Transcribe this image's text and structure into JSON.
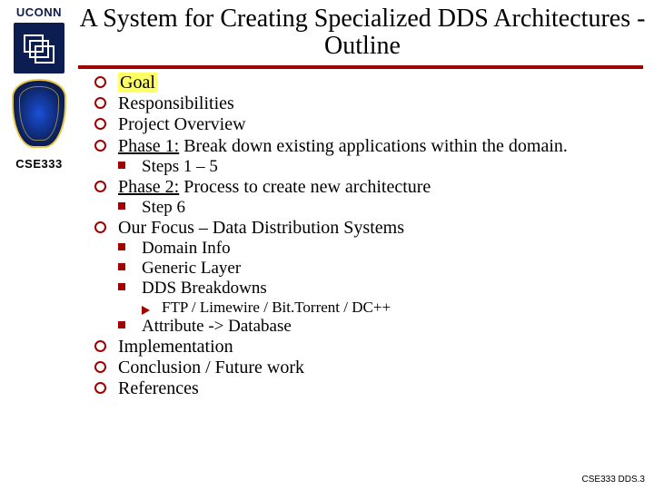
{
  "brand": {
    "university": "UCONN",
    "course": "CSE333"
  },
  "title": "A System for Creating Specialized DDS Architectures - Outline",
  "outline": {
    "i1": "Goal",
    "i2": "Responsibilities",
    "i3": "Project Overview",
    "i4_label": "Phase 1:",
    "i4_rest": " Break down existing applications within the domain.",
    "i4a": "Steps 1 – 5",
    "i5_label": "Phase 2:",
    "i5_rest": " Process to create new architecture",
    "i5a": "Step 6",
    "i6": "Our Focus – Data Distribution Systems",
    "i6a": "Domain Info",
    "i6b": "Generic Layer",
    "i6c": "DDS Breakdowns",
    "i6c1": "FTP / Limewire / Bit.Torrent / DC++",
    "i6d": "Attribute -> Database",
    "i7": "Implementation",
    "i8": "Conclusion / Future work",
    "i9": "References"
  },
  "footer": "CSE333 DDS.3"
}
